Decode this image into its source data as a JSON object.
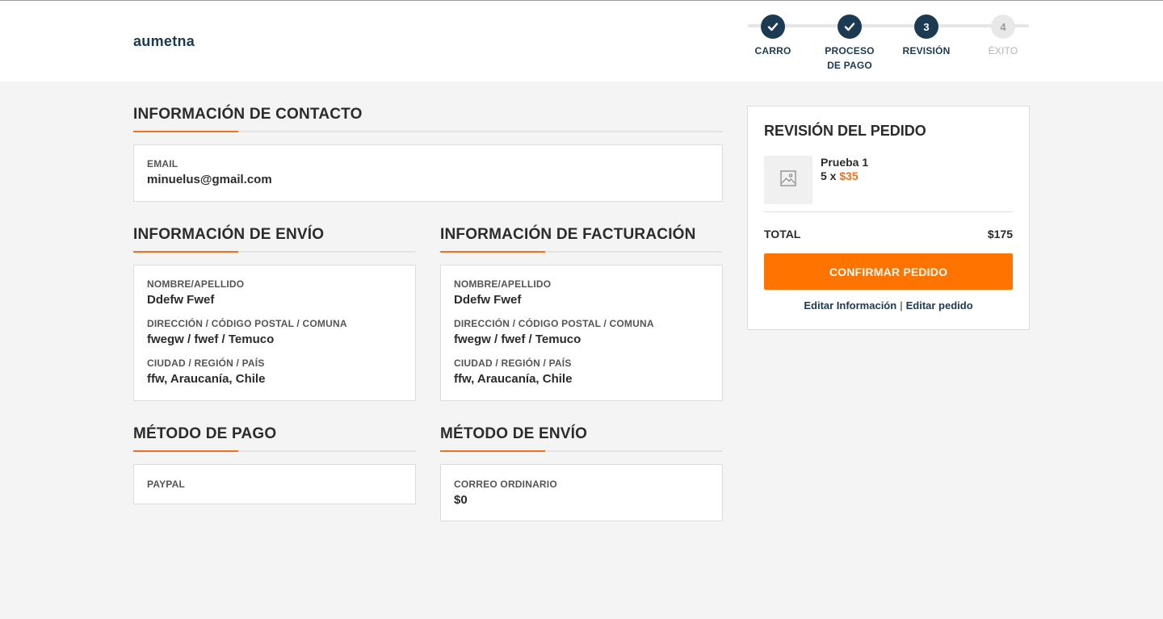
{
  "header": {
    "logo": "aumetna",
    "steps": [
      {
        "label_line1": "CARRO",
        "label_line2": "",
        "status": "done",
        "number": "1"
      },
      {
        "label_line1": "PROCESO",
        "label_line2": "DE PAGO",
        "status": "done",
        "number": "2"
      },
      {
        "label_line1": "REVISIÓN",
        "label_line2": "",
        "status": "current",
        "number": "3"
      },
      {
        "label_line1": "ÉXITO",
        "label_line2": "",
        "status": "pending",
        "number": "4"
      }
    ]
  },
  "contact": {
    "title": "INFORMACIÓN DE CONTACTO",
    "email_label": "EMAIL",
    "email_value": "minuelus@gmail.com"
  },
  "shipping": {
    "title": "INFORMACIÓN DE ENVÍO",
    "name_label": "NOMBRE/APELLIDO",
    "name_value": "Ddefw Fwef",
    "address_label": "DIRECCIÓN / CÓDIGO POSTAL / COMUNA",
    "address_value": "fwegw / fwef / Temuco",
    "city_label": "CIUDAD / REGIÓN / PAÍS",
    "city_value": "ffw, Araucanía, Chile"
  },
  "billing": {
    "title": "INFORMACIÓN DE FACTURACIÓN",
    "name_label": "NOMBRE/APELLIDO",
    "name_value": "Ddefw Fwef",
    "address_label": "DIRECCIÓN / CÓDIGO POSTAL / COMUNA",
    "address_value": "fwegw / fwef / Temuco",
    "city_label": "CIUDAD / REGIÓN / PAÍS",
    "city_value": "ffw, Araucanía, Chile"
  },
  "payment": {
    "title": "MÉTODO DE PAGO",
    "method": "PAYPAL"
  },
  "delivery": {
    "title": "MÉTODO DE ENVÍO",
    "method": "CORREO ORDINARIO",
    "cost": "$0"
  },
  "summary": {
    "title": "REVISIÓN DEL PEDIDO",
    "item_name": "Prueba 1",
    "item_qty": "5 x ",
    "item_price": "$35",
    "total_label": "TOTAL",
    "total_value": "$175",
    "confirm_label": "CONFIRMAR PEDIDO",
    "edit_info_label": "Editar Información",
    "separator": "|",
    "edit_order_label": "Editar pedido"
  },
  "colors": {
    "accent": "#ff7300",
    "navy": "#1c3a52",
    "background": "#f4f4f4"
  },
  "icons": {
    "step_done": "check-icon",
    "thumbnail": "image-placeholder-icon"
  }
}
